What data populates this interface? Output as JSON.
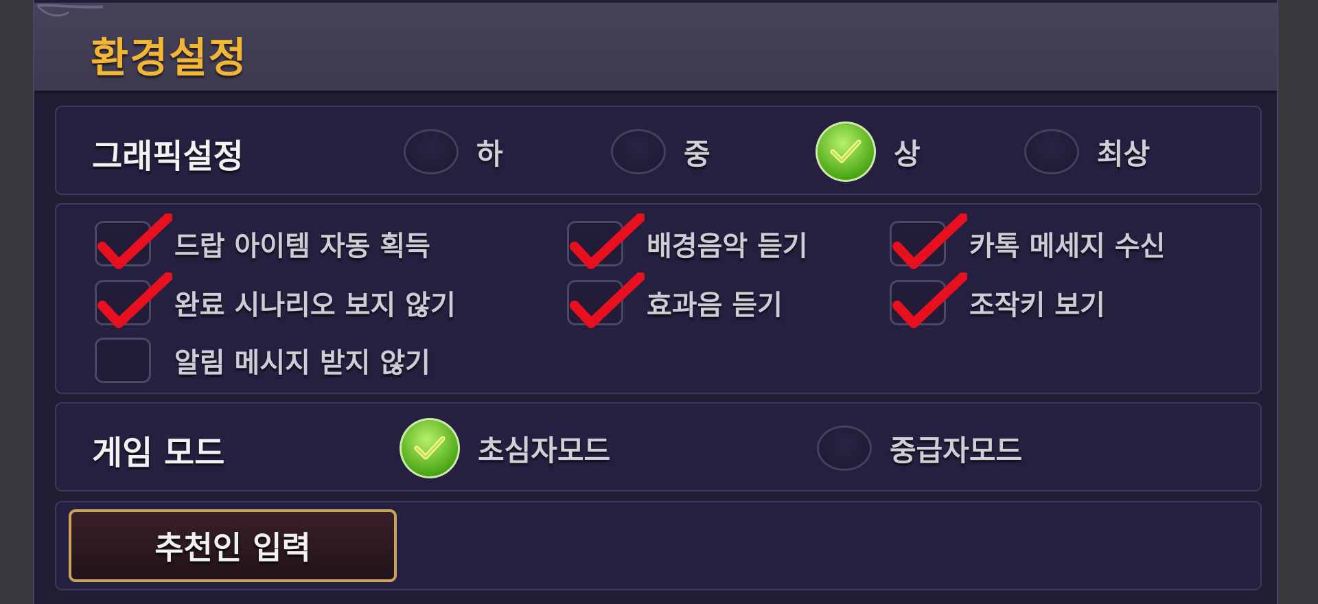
{
  "window": {
    "title": "환경설정"
  },
  "graphics": {
    "label": "그래픽설정",
    "options": [
      {
        "label": "하",
        "selected": false
      },
      {
        "label": "중",
        "selected": false
      },
      {
        "label": "상",
        "selected": true
      },
      {
        "label": "최상",
        "selected": false
      }
    ]
  },
  "toggles": [
    {
      "label": "드랍 아이템 자동 획득",
      "checked": true
    },
    {
      "label": "배경음악 듣기",
      "checked": true
    },
    {
      "label": "카톡 메세지 수신",
      "checked": true
    },
    {
      "label": "완료 시나리오 보지 않기",
      "checked": true
    },
    {
      "label": "효과음 듣기",
      "checked": true
    },
    {
      "label": "조작키 보기",
      "checked": true
    },
    {
      "label": "알림 메시지 받지 않기",
      "checked": false
    }
  ],
  "game_mode": {
    "label": "게임 모드",
    "options": [
      {
        "label": "초심자모드",
        "selected": true
      },
      {
        "label": "중급자모드",
        "selected": false
      }
    ]
  },
  "referral": {
    "button_label": "추천인 입력"
  },
  "colors": {
    "accent": "#f2b632",
    "check": "#e8101e",
    "radio_on": "#5cb61a",
    "panel": "#221d35"
  },
  "icons": {
    "check": "red-checkmark-icon",
    "radio_selected": "green-check-icon"
  }
}
